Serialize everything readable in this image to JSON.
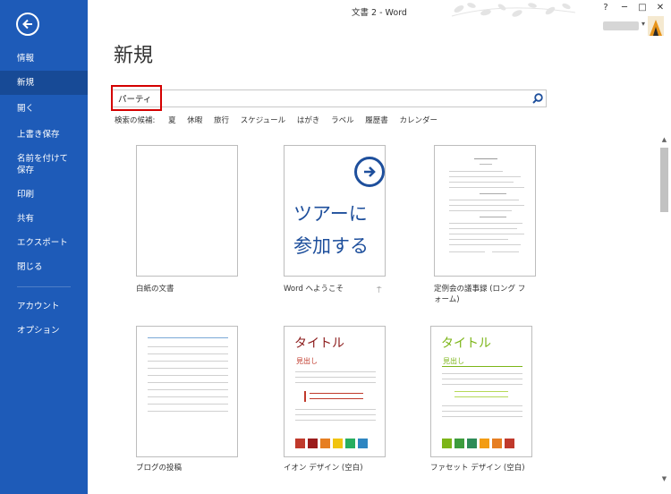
{
  "window": {
    "title": "文書 2 - Word",
    "help": "?",
    "minimize": "─",
    "restore": "□",
    "close": "✕"
  },
  "sidebar": {
    "items": [
      {
        "label": "情報"
      },
      {
        "label": "新規",
        "active": true
      },
      {
        "label": "開く"
      },
      {
        "label": "上書き保存"
      },
      {
        "label": "名前を付けて保存"
      },
      {
        "label": "印刷"
      },
      {
        "label": "共有"
      },
      {
        "label": "エクスポート"
      },
      {
        "label": "閉じる"
      },
      {
        "label": "アカウント"
      },
      {
        "label": "オプション"
      }
    ]
  },
  "main": {
    "title": "新規",
    "search": {
      "value": "パーティ"
    },
    "suggestions": {
      "label": "検索の候補:",
      "items": [
        "夏",
        "休暇",
        "旅行",
        "スケジュール",
        "はがき",
        "ラベル",
        "履歴書",
        "カレンダー"
      ]
    },
    "templates": [
      {
        "label": "白紙の文書"
      },
      {
        "label": "Word へようこそ",
        "thumb_text_1": "ツアーに",
        "thumb_text_2": "参加する"
      },
      {
        "label": "定例会の議事録 (ロング フォーム)"
      },
      {
        "label": "ブログの投稿"
      },
      {
        "label": "イオン デザイン (空白)",
        "thumb_title": "タイトル",
        "thumb_sub": "見出し",
        "swatches": [
          "#c0392b",
          "#9b1c1c",
          "#e67e22",
          "#f1c40f",
          "#27ae60",
          "#2e86c1",
          "#1abc9c",
          "#8e44ad"
        ]
      },
      {
        "label": "ファセット デザイン (空白)",
        "thumb_title": "タイトル",
        "thumb_sub": "見出し",
        "swatches": [
          "#7cb518",
          "#3d9c3d",
          "#2e8b57",
          "#f39c12",
          "#e67e22",
          "#c0392b",
          "#2c3e50",
          "#8b6914"
        ]
      }
    ]
  },
  "colors": {
    "sidebar": "#1e5bb8",
    "sidebar_active": "#174a96",
    "highlight": "#d40000"
  }
}
